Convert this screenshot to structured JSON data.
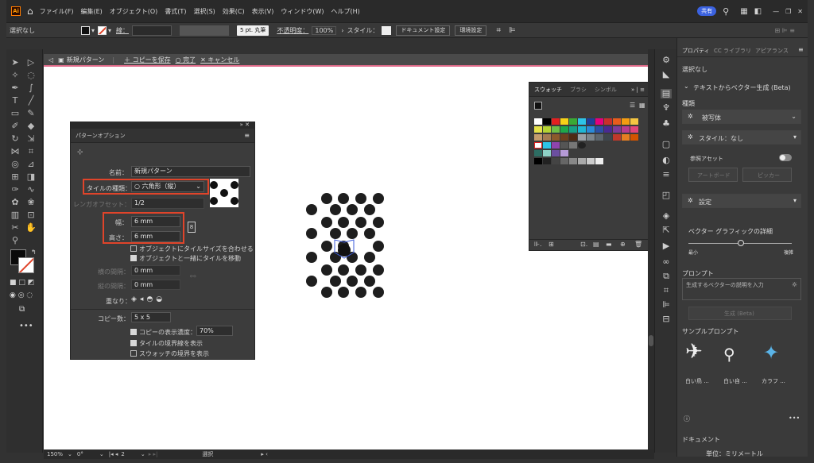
{
  "menu": [
    "ファイル(F)",
    "編集(E)",
    "オブジェクト(O)",
    "書式(T)",
    "選択(S)",
    "効果(C)",
    "表示(V)",
    "ウィンドウ(W)",
    "ヘルプ(H)"
  ],
  "share_label": "共有",
  "control": {
    "selection": "選択なし",
    "stroke_label": "線：",
    "brush": "5 pt. 丸筆",
    "opacity_label": "不透明度：",
    "opacity": "100%",
    "style_label": "スタイル：",
    "doc_setup": "ドキュメント設定",
    "prefs": "環境設定"
  },
  "isolation": {
    "name": "新規パターン",
    "save_copy": "＋ コピーを保存",
    "done": "○ 完了",
    "cancel": "✕ キャンセル"
  },
  "pattern_options": {
    "title": "パターンオプション",
    "name_label": "名前：",
    "name_value": "新規パターン",
    "tile_type_label": "タイルの種類：",
    "tile_type_value": "六角形（縦）",
    "brick_offset_label": "レンガオフセット：",
    "brick_offset_value": "1/2",
    "width_label": "幅：",
    "width_value": "6 mm",
    "height_label": "高さ：",
    "height_value": "6 mm",
    "fit_tile": "オブジェクトにタイルサイズを合わせる",
    "move_tile": "オブジェクトと一緒にタイルを移動",
    "h_spacing_label": "横の間隔：",
    "h_spacing_value": "0 mm",
    "v_spacing_label": "縦の間隔：",
    "v_spacing_value": "0 mm",
    "overlap_label": "重なり：",
    "copies_label": "コピー数：",
    "copies_value": "5 x 5",
    "dim_copies": "コピーの表示濃度：",
    "dim_value": "70%",
    "show_tile_edge": "タイルの境界線を表示",
    "show_swatch_bounds": "スウォッチの境界を表示"
  },
  "swatches": {
    "tabs": [
      "スウォッチ",
      "ブラシ",
      "シンボル"
    ]
  },
  "properties": {
    "tabs": [
      "プロパティ",
      "CC ライブラリ",
      "アピアランス"
    ],
    "no_selection": "選択なし",
    "text_to_vector": "テキストからベクター生成 (Beta)",
    "type_label": "種類",
    "type_value": "被写体",
    "style_label": "スタイル：なし",
    "ref_asset": "参照アセット",
    "artboard_btn": "アートボード",
    "picker_btn": "ピッカー",
    "settings_label": "設定",
    "detail_label": "ベクター グラフィックの詳細",
    "min_label": "最小",
    "max_label": "複雑",
    "prompt_label": "プロンプト",
    "prompt_placeholder": "生成するベクターの説明を入力",
    "generate_btn": "生成 (Beta)",
    "sample_label": "サンプルプロンプト",
    "samples": [
      "白い鳥 ...",
      "白い自 ...",
      "カラフ ..."
    ],
    "document_label": "ドキュメント",
    "unit_label": "単位：ミリメートル"
  },
  "status": {
    "zoom": "150%",
    "rotate": "0°",
    "page": "2",
    "mode": "選択"
  },
  "colors": {
    "accent_red": "#e0442a",
    "panel_bg": "#3c3c3c",
    "artboard": "#ffffff"
  }
}
